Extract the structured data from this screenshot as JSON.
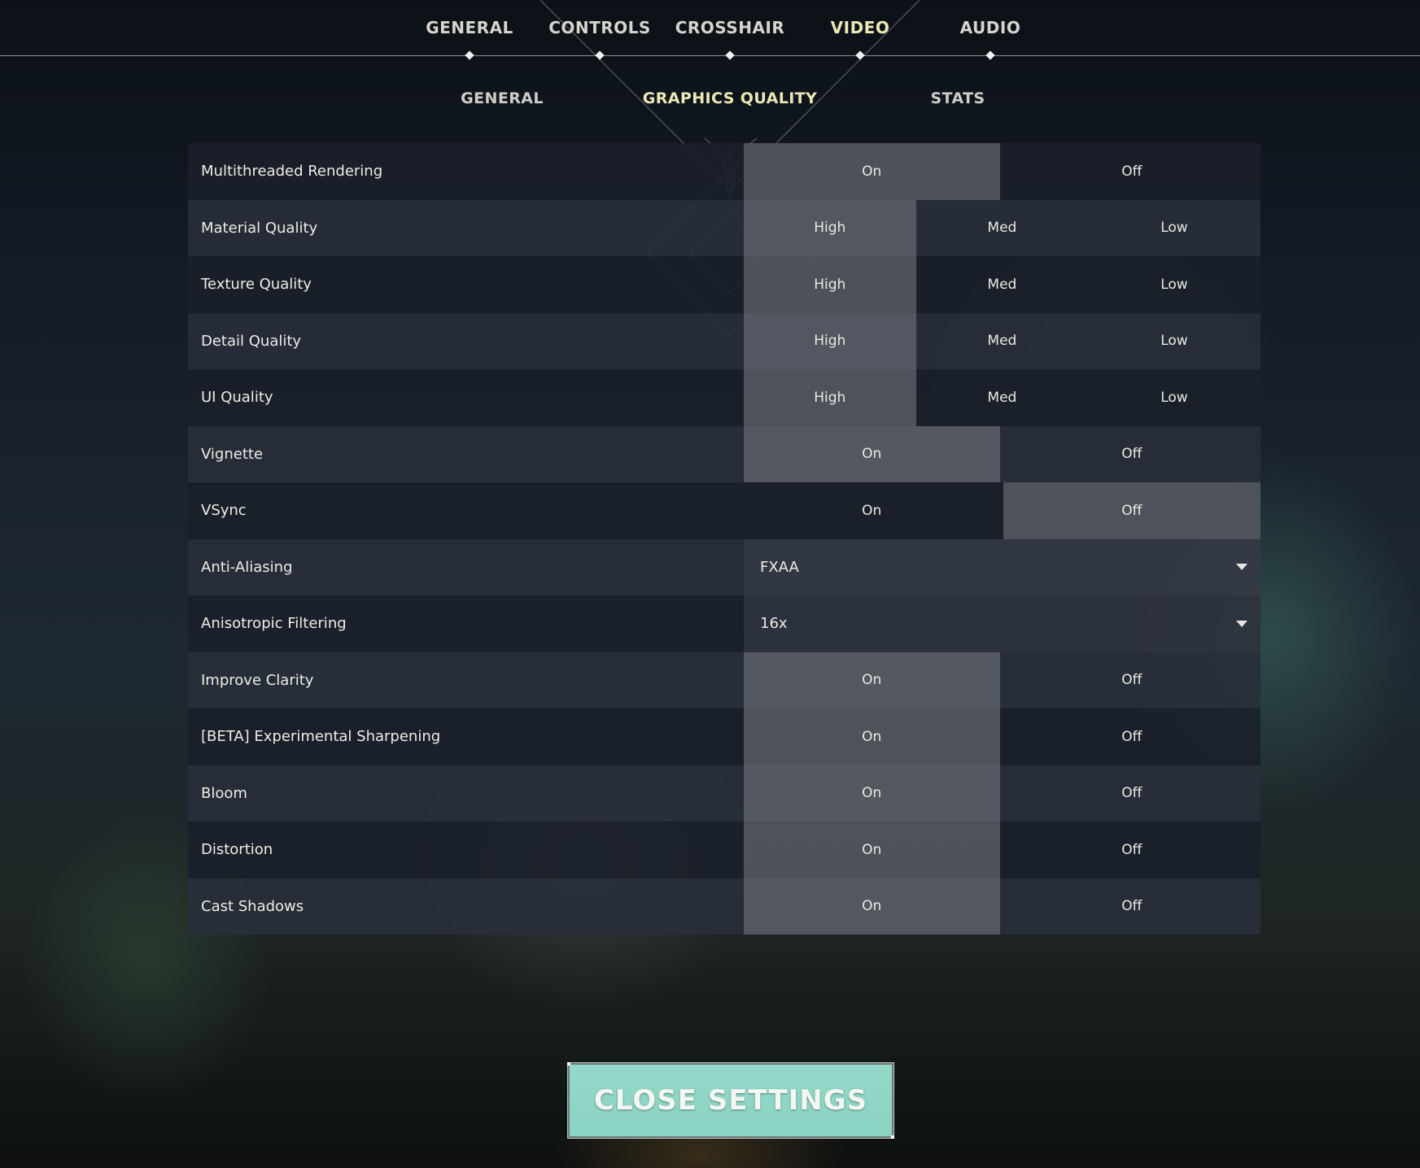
{
  "top_tabs": [
    {
      "label": "GENERAL",
      "active": false
    },
    {
      "label": "CONTROLS",
      "active": false
    },
    {
      "label": "CROSSHAIR",
      "active": false
    },
    {
      "label": "VIDEO",
      "active": true
    },
    {
      "label": "AUDIO",
      "active": false
    }
  ],
  "sub_tabs": [
    {
      "label": "GENERAL",
      "active": false
    },
    {
      "label": "GRAPHICS QUALITY",
      "active": true
    },
    {
      "label": "STATS",
      "active": false
    }
  ],
  "settings": [
    {
      "label": "Multithreaded Rendering",
      "type": "toggle",
      "options": [
        "On",
        "Off"
      ],
      "selected": 0
    },
    {
      "label": "Material Quality",
      "type": "choice",
      "options": [
        "High",
        "Med",
        "Low"
      ],
      "selected": 0
    },
    {
      "label": "Texture Quality",
      "type": "choice",
      "options": [
        "High",
        "Med",
        "Low"
      ],
      "selected": 0
    },
    {
      "label": "Detail Quality",
      "type": "choice",
      "options": [
        "High",
        "Med",
        "Low"
      ],
      "selected": 0
    },
    {
      "label": "UI Quality",
      "type": "choice",
      "options": [
        "High",
        "Med",
        "Low"
      ],
      "selected": 0
    },
    {
      "label": "Vignette",
      "type": "toggle",
      "options": [
        "On",
        "Off"
      ],
      "selected": 0
    },
    {
      "label": "VSync",
      "type": "toggle",
      "options": [
        "On",
        "Off"
      ],
      "selected": 1
    },
    {
      "label": "Anti-Aliasing",
      "type": "dropdown",
      "value": "FXAA"
    },
    {
      "label": "Anisotropic Filtering",
      "type": "dropdown",
      "value": "16x"
    },
    {
      "label": "Improve Clarity",
      "type": "toggle",
      "options": [
        "On",
        "Off"
      ],
      "selected": 0
    },
    {
      "label": "[BETA] Experimental Sharpening",
      "type": "toggle",
      "options": [
        "On",
        "Off"
      ],
      "selected": 0
    },
    {
      "label": "Bloom",
      "type": "toggle",
      "options": [
        "On",
        "Off"
      ],
      "selected": 0
    },
    {
      "label": "Distortion",
      "type": "toggle",
      "options": [
        "On",
        "Off"
      ],
      "selected": 0
    },
    {
      "label": "Cast Shadows",
      "type": "toggle",
      "options": [
        "On",
        "Off"
      ],
      "selected": 0
    }
  ],
  "close_button": {
    "label": "CLOSE SETTINGS"
  },
  "colors": {
    "active_tab": "#ece8b6",
    "close_button": "#8dd5c4",
    "selected_option": "#6b6f77"
  }
}
